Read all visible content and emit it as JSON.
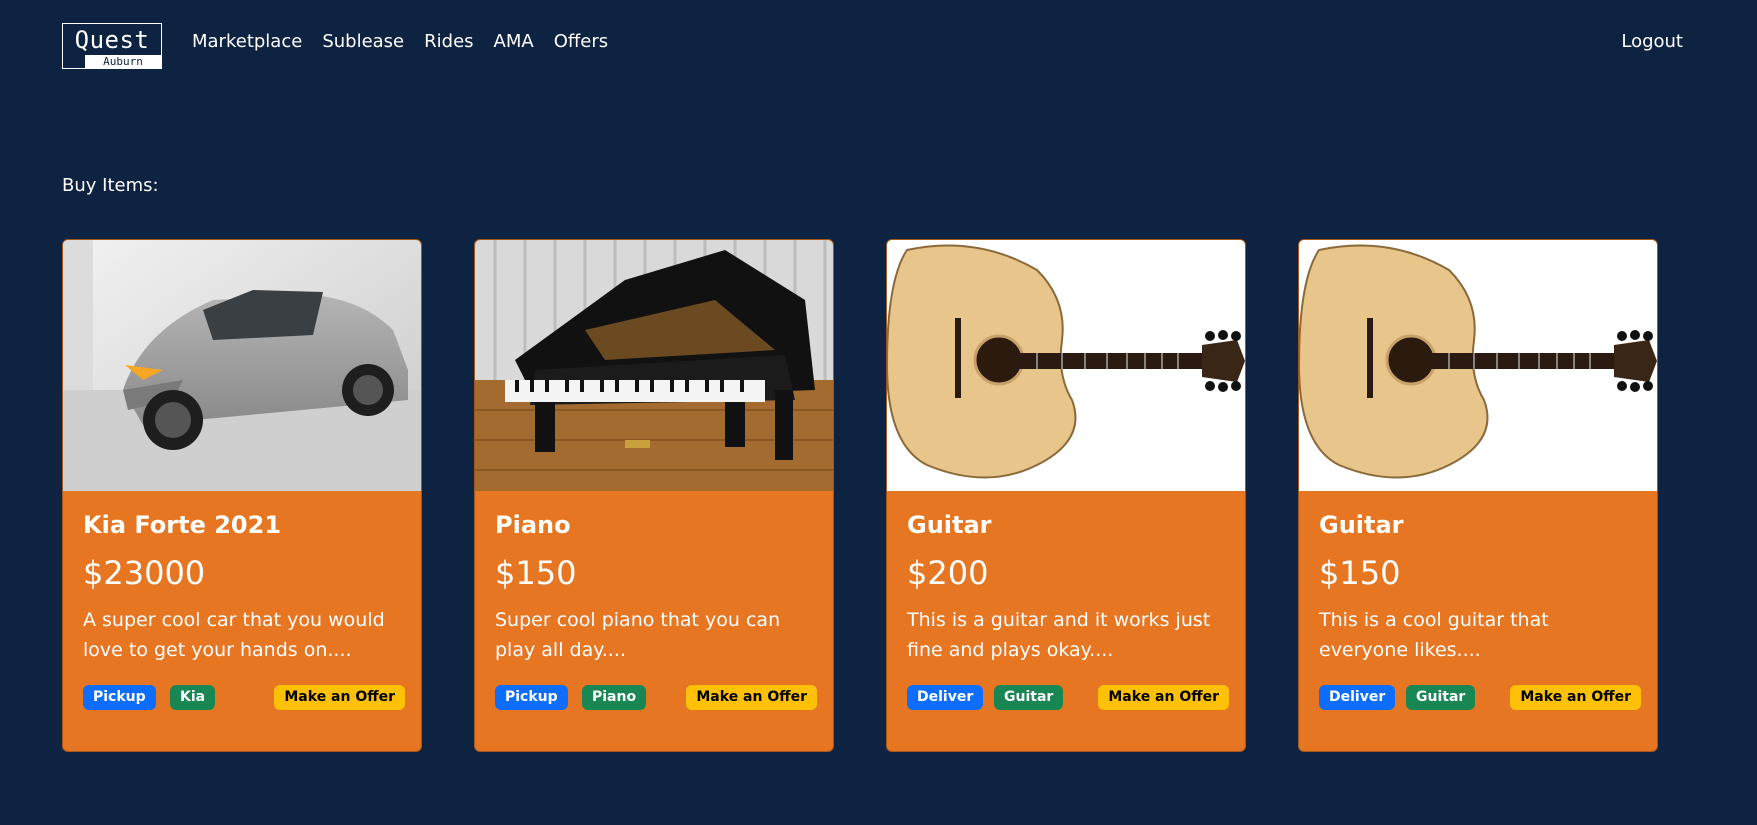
{
  "nav": {
    "logo_main": "Quest",
    "logo_sub": "Auburn",
    "links": [
      "Marketplace",
      "Sublease",
      "Rides",
      "AMA",
      "Offers"
    ],
    "logout": "Logout"
  },
  "section_title": "Buy Items:",
  "items": [
    {
      "title": "Kia Forte 2021",
      "price": "$23000",
      "description": "A super cool car that you would love to get your hands on....",
      "badges": [
        "Pickup",
        "Kia"
      ],
      "offer_label": "Make an Offer",
      "image": "car-photo"
    },
    {
      "title": "Piano",
      "price": "$150",
      "description": "Super cool piano that you can play all day....",
      "badges": [
        "Pickup",
        "Piano"
      ],
      "offer_label": "Make an Offer",
      "image": "piano-photo"
    },
    {
      "title": "Guitar",
      "price": "$200",
      "description": "This is a guitar and it works just fine and plays okay....",
      "badges": [
        "Deliver",
        "Guitar"
      ],
      "offer_label": "Make an Offer",
      "image": "guitar-photo"
    },
    {
      "title": "Guitar",
      "price": "$150",
      "description": "This is a cool guitar that everyone likes....",
      "badges": [
        "Deliver",
        "Guitar"
      ],
      "offer_label": "Make an Offer",
      "image": "guitar-photo"
    }
  ],
  "colors": {
    "background": "#0e2241",
    "card": "#e67621",
    "badge_blue": "#0d6efd",
    "badge_green": "#198754",
    "offer_yellow": "#ffc107"
  }
}
